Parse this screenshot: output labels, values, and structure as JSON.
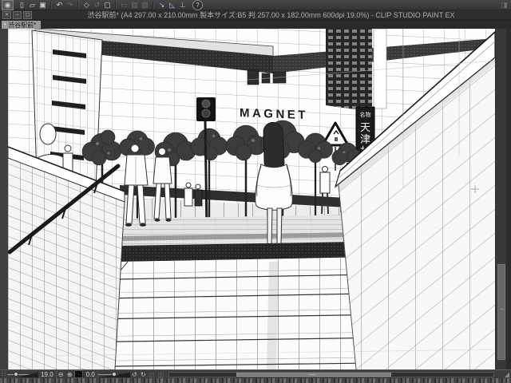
{
  "colors": {
    "ui_bg": "#3a3a3a",
    "titlebar_bg": "#2e2e2e",
    "tab_active_bg": "#9b9b9b",
    "canvas_bg": "#ffffff",
    "ink": "#2a2a2a",
    "snap_icon_accent": "#9cc0e8"
  },
  "window": {
    "title": "渋谷駅前* (A4 297.00 x 210.00mm 製本サイズ:B5 判 257.00 x 182.00mm 600dpi 19.0%) - CLIP STUDIO PAINT EX"
  },
  "tabbar": {
    "active_tab": "渋谷駅前*"
  },
  "icons": {
    "logo_eye": "◉",
    "new_file": "▯",
    "open_file": "▱",
    "save_file": "▣",
    "undo": "↶",
    "redo": "↷",
    "move_tool": "◇",
    "rotate_tool": "↺",
    "fit_tool": "▢",
    "transform_a": "▭",
    "transform_b": "▨",
    "transform_c": "▧",
    "snap_arrow": "↘",
    "snap_ruler": "◺",
    "snap_special": "⊥",
    "help": "?",
    "panel_toggle": "◨",
    "win_close": "✕",
    "win_min": "─",
    "win_max": "▢",
    "tab_dot": "▪",
    "grip": "∷",
    "zoom_out": "⊖",
    "zoom_in": "⊕",
    "fit_black": "■",
    "rotate_left": "↺",
    "rotate_right": "↻",
    "reset_view": "◻",
    "flip_view": "◫",
    "resize_grip": "◢"
  },
  "artwork": {
    "signs": {
      "magnet": "MAGNET",
      "vertical_header": "名物",
      "vertical_body": "天津甘栗"
    }
  },
  "statusbar": {
    "zoom_value": "19.0",
    "rotation_value": "0.0"
  }
}
